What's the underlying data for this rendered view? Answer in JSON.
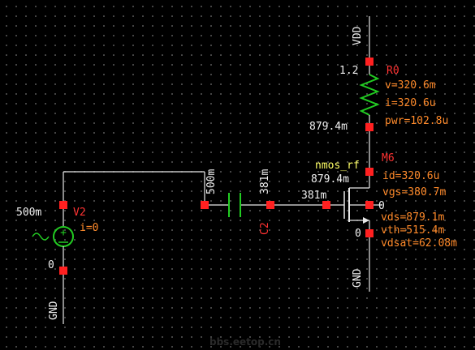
{
  "colors": {
    "background": "#000000",
    "wire": "#e8e8e8",
    "pin": "#ff2020",
    "label_red": "#ff3232",
    "annotation_orange": "#ff8a2a",
    "model_yellow": "#ffff66",
    "resistor_green": "#22cc22",
    "capacitor_green": "#22cc22",
    "source_green": "#22cc22"
  },
  "supply_top": {
    "label": "VDD"
  },
  "resistor": {
    "name": "R0",
    "top_voltage": "1.2",
    "bottom_voltage": "879.4m",
    "annotations": [
      "v=320.6m",
      "i=320.6u",
      "pwr=102.8u"
    ]
  },
  "transistor": {
    "name": "M6",
    "model": "nmos_rf",
    "drain_voltage": "879.4m",
    "gate_voltage": "381m",
    "source_voltage": "0",
    "body_voltage": "0",
    "annotations": [
      "id=320.6u",
      "vgs=380.7m",
      "vds=879.1m",
      "vth=515.4m",
      "vdsat=62.08m"
    ]
  },
  "capacitor": {
    "name": "C2",
    "left_voltage": "500m",
    "right_voltage": "381m"
  },
  "source": {
    "name": "V2",
    "top_voltage": "500m",
    "bottom_voltage": "0",
    "annotation": "i=0"
  },
  "ground_source": {
    "label": "GND"
  },
  "ground_transistor": {
    "label": "GND"
  },
  "watermark": "bbs.eetop.cn"
}
